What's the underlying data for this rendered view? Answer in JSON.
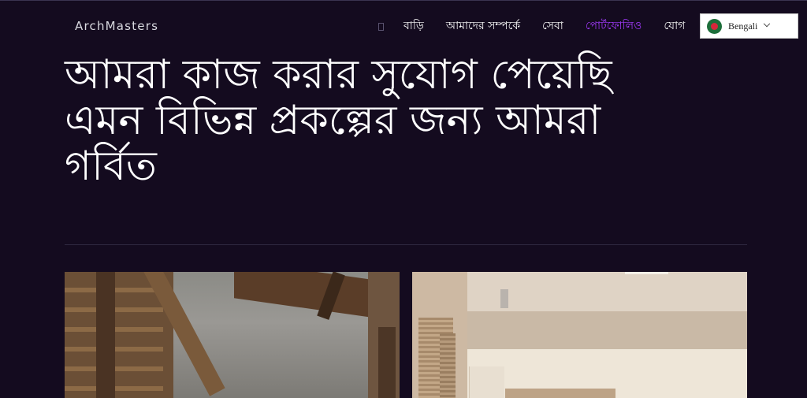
{
  "brand": {
    "name": "ArchMasters"
  },
  "nav": {
    "items": [
      {
        "label": "বাড়ি",
        "active": false
      },
      {
        "label": "আমাদের সম্পর্কে",
        "active": false
      },
      {
        "label": "সেবা",
        "active": false
      },
      {
        "label": "পোর্টফোলিও",
        "active": true
      },
      {
        "label": "যোগ",
        "active": false
      }
    ]
  },
  "language_selector": {
    "value": "Bengali",
    "flag_icon": "bangladesh-flag-icon"
  },
  "hero": {
    "title": "আমরা কাজ করার সুযোগ পেয়েছি এমন বিভিন্ন প্রকল্পের জন্য আমরা গর্বিত"
  },
  "colors": {
    "background": "#140b1f",
    "accent": "#a43bff",
    "text": "#ffffff"
  },
  "portfolio": {
    "cards": [
      {
        "image": "wooden-stair-concrete-interior"
      },
      {
        "image": "minimal-beige-interior"
      }
    ]
  }
}
